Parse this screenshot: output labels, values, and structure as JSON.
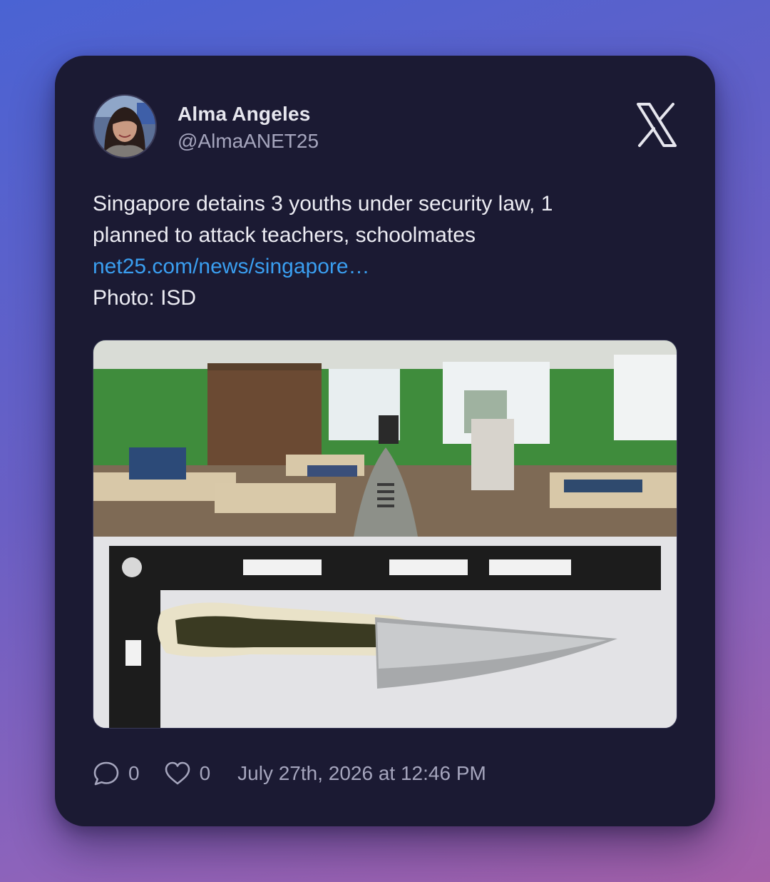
{
  "author": {
    "name": "Alma Angeles",
    "handle": "@AlmaANET25"
  },
  "tweet": {
    "line1": "Singapore detains 3 youths under security law, 1",
    "line2": "planned to attack teachers, schoolmates",
    "link": "net25.com/news/singapore…",
    "line4": "Photo: ISD"
  },
  "footer": {
    "replies": "0",
    "likes": "0",
    "timestamp": "July 27th, 2026 at 12:46 PM"
  },
  "colors": {
    "card_bg": "#1b1a33",
    "link": "#3a9ef0",
    "muted": "#a5a5bd"
  },
  "icons": [
    "x-logo-icon",
    "reply-icon",
    "heart-icon"
  ]
}
